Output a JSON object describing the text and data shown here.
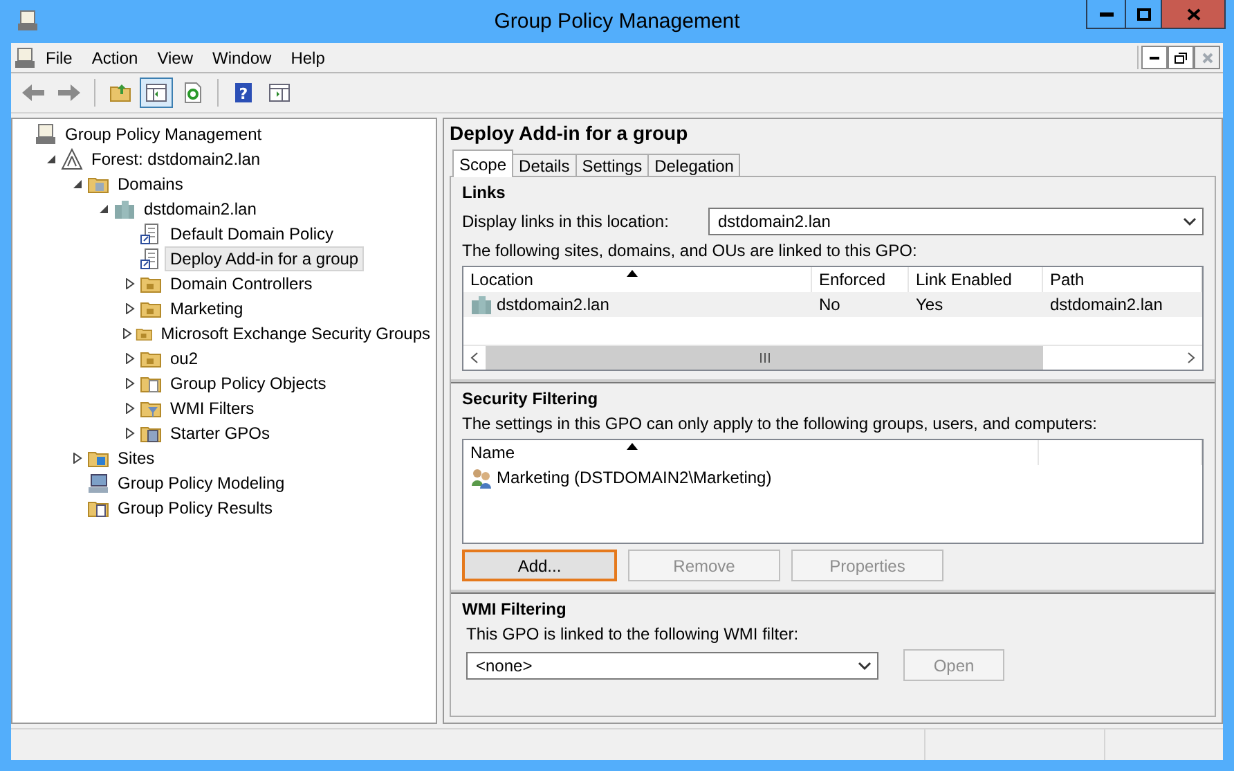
{
  "window": {
    "title": "Group Policy Management"
  },
  "menu": [
    "File",
    "Action",
    "View",
    "Window",
    "Help"
  ],
  "toolbar": [
    {
      "kind": "back",
      "pressed": false
    },
    {
      "kind": "forward",
      "pressed": false
    },
    {
      "kind": "up",
      "pressed": false
    },
    {
      "kind": "tree-toggle",
      "pressed": true
    },
    {
      "kind": "refresh",
      "pressed": false
    },
    {
      "kind": "help",
      "pressed": false,
      "glyph": "?"
    },
    {
      "kind": "action-pane",
      "pressed": false
    }
  ],
  "tree": [
    {
      "label": "Group Policy Management",
      "kind": "root",
      "selected": false,
      "children": [
        {
          "label": "Forest: dstdomain2.lan",
          "kind": "forest",
          "selected": false,
          "expanded": true,
          "children": [
            {
              "label": "Domains",
              "kind": "domains",
              "selected": false,
              "expanded": true,
              "children": [
                {
                  "label": "dstdomain2.lan",
                  "kind": "domain",
                  "selected": false,
                  "expanded": true,
                  "children": [
                    {
                      "label": "Default Domain Policy",
                      "kind": "gpo-link",
                      "selected": false
                    },
                    {
                      "label": "Deploy Add-in for a group",
                      "kind": "gpo-link",
                      "selected": true
                    },
                    {
                      "label": "Domain Controllers",
                      "kind": "ou",
                      "selected": false,
                      "expanded": false
                    },
                    {
                      "label": "Marketing",
                      "kind": "ou",
                      "selected": false,
                      "expanded": false
                    },
                    {
                      "label": "Microsoft Exchange Security Groups",
                      "kind": "ou",
                      "selected": false,
                      "expanded": false
                    },
                    {
                      "label": "ou2",
                      "kind": "ou",
                      "selected": false,
                      "expanded": false
                    },
                    {
                      "label": "Group Policy Objects",
                      "kind": "gpo-folder",
                      "selected": false,
                      "expanded": false
                    },
                    {
                      "label": "WMI Filters",
                      "kind": "wmi",
                      "selected": false,
                      "expanded": false
                    },
                    {
                      "label": "Starter GPOs",
                      "kind": "starter",
                      "selected": false,
                      "expanded": false
                    }
                  ]
                }
              ]
            },
            {
              "label": "Sites",
              "kind": "sites",
              "selected": false,
              "expanded": false
            },
            {
              "label": "Group Policy Modeling",
              "kind": "modeling",
              "selected": false
            },
            {
              "label": "Group Policy Results",
              "kind": "results",
              "selected": false
            }
          ]
        }
      ]
    }
  ],
  "detail": {
    "title": "Deploy Add-in for a group",
    "tabs": [
      {
        "label": "Scope",
        "selected": true
      },
      {
        "label": "Details",
        "selected": false
      },
      {
        "label": "Settings",
        "selected": false
      },
      {
        "label": "Delegation",
        "selected": false
      }
    ],
    "links": {
      "heading": "Links",
      "location_label": "Display links in this location:",
      "location_value": "dstdomain2.lan",
      "list_label": "The following sites, domains, and OUs are linked to this GPO:",
      "columns": [
        "Location",
        "Enforced",
        "Link Enabled",
        "Path"
      ],
      "rows": [
        {
          "cells": [
            "dstdomain2.lan",
            "No",
            "Yes",
            "dstdomain2.lan"
          ],
          "selected": false
        }
      ]
    },
    "security": {
      "heading": "Security Filtering",
      "list_label": "The settings in this GPO can only apply to the following groups, users, and computers:",
      "columns": [
        "Name"
      ],
      "rows": [
        {
          "cells": [
            "Marketing (DSTDOMAIN2\\Marketing)"
          ],
          "selected": false
        }
      ],
      "buttons": [
        {
          "label": "Add...",
          "disabled": false,
          "focused": true
        },
        {
          "label": "Remove",
          "disabled": true,
          "focused": false
        },
        {
          "label": "Properties",
          "disabled": true,
          "focused": false
        }
      ]
    },
    "wmi": {
      "heading": "WMI Filtering",
      "label": "This GPO is linked to the following WMI filter:",
      "value": "<none>",
      "button": {
        "label": "Open",
        "disabled": true
      }
    }
  }
}
